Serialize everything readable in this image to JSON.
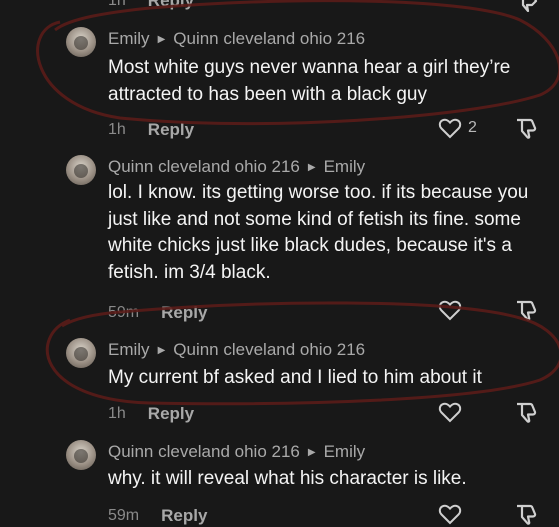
{
  "top_partial": {
    "time": "1h",
    "reply": "Reply"
  },
  "comments": [
    {
      "author": "Emily",
      "reply_to": "Quinn cleveland ohio 216",
      "text": "Most white guys never wanna hear a girl they’re attracted to has been with a black guy",
      "time": "1h",
      "reply": "Reply",
      "likes": "2"
    },
    {
      "author": "Quinn cleveland ohio 216",
      "reply_to": "Emily",
      "text": "lol. I know. its getting worse too. if its because you just like and not some kind of fetish its fine. some white chicks just like black dudes, because it's a fetish. im 3/4 black.",
      "time": "59m",
      "reply": "Reply",
      "likes": ""
    },
    {
      "author": "Emily",
      "reply_to": "Quinn cleveland ohio 216",
      "text": "My current bf asked and I lied to him about it",
      "time": "1h",
      "reply": "Reply",
      "likes": ""
    },
    {
      "author": "Quinn cleveland ohio 216",
      "reply_to": "Emily",
      "text": "why. it will reveal what his character is like.",
      "time": "59m",
      "reply": "Reply",
      "likes": ""
    }
  ],
  "colors": {
    "annotation": "#5a1c18",
    "background": "#181818"
  }
}
